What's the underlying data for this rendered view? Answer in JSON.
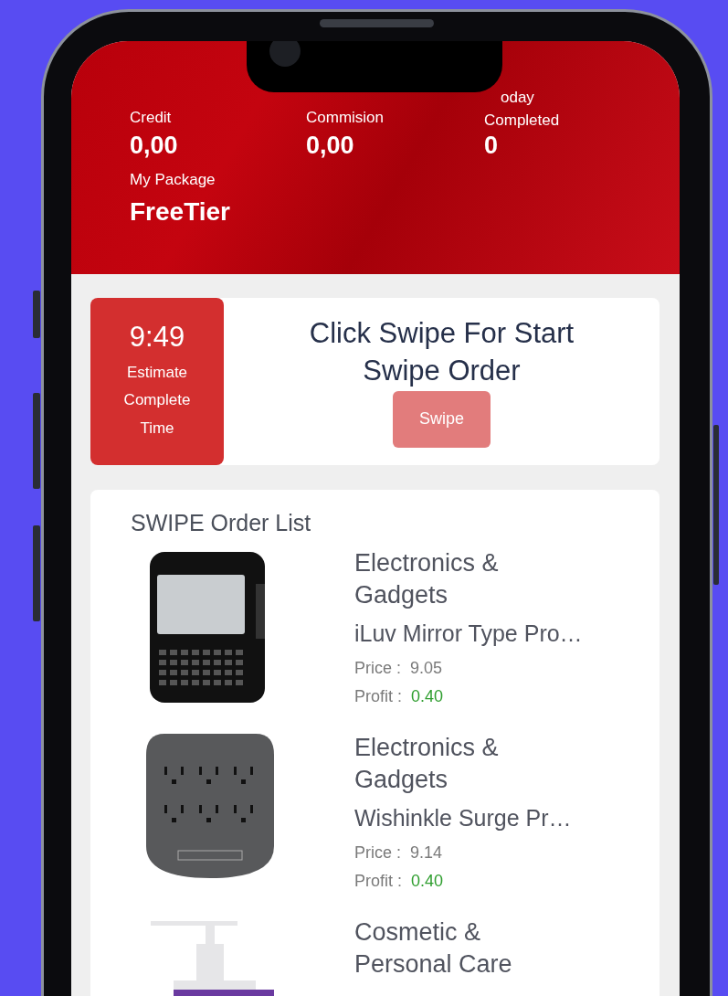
{
  "header": {
    "stats": [
      {
        "label": "Credit",
        "value": "0,00"
      },
      {
        "label": "Commision",
        "value": "0,00"
      },
      {
        "label": "oday Completed",
        "value": "0"
      }
    ],
    "package": {
      "label": "My Package",
      "value": "FreeTier"
    }
  },
  "timer": {
    "time": "9:49",
    "caption": "Estimate Complete Time"
  },
  "start": {
    "title": "Click Swipe For Start Swipe Order",
    "button": "Swipe",
    "disabled": true
  },
  "orders": {
    "title": "SWIPE Order List",
    "items": [
      {
        "kind": "phone",
        "category": "Electronics & Gadgets",
        "name": "iLuv Mirror Type Pro…",
        "price_label": "Price :",
        "price": "9.05",
        "profit_label": "Profit :",
        "profit": "0.40"
      },
      {
        "kind": "power-strip",
        "category": "Electronics & Gadgets",
        "name": "Wishinkle Surge Pr…",
        "price_label": "Price :",
        "price": "9.14",
        "profit_label": "Profit :",
        "profit": "0.40"
      },
      {
        "kind": "bottle",
        "category": "Cosmetic & Personal Care"
      }
    ]
  }
}
